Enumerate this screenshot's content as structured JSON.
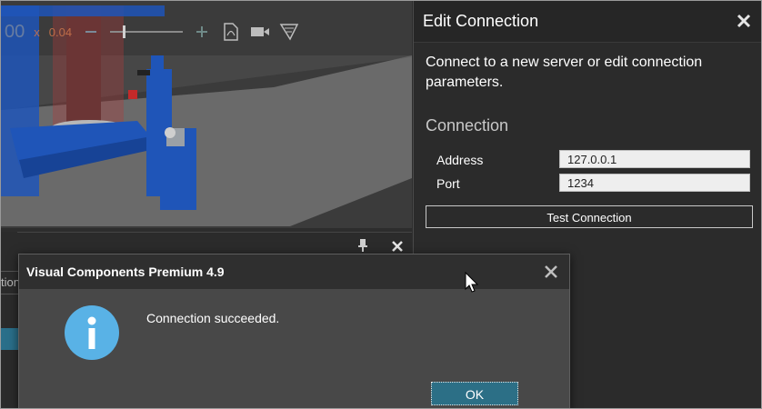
{
  "viewport": {
    "zoom_value": "00",
    "scale_prefix": "x",
    "scale_value": "0.04",
    "toolbar_icons": [
      "zoom-minus-icon",
      "slider-icon",
      "zoom-plus-icon",
      "pdf-export-icon",
      "video-record-icon",
      "render-mode-icon"
    ]
  },
  "edit_connection": {
    "title": "Edit Connection",
    "description": "Connect to a new server or edit connection parameters.",
    "section_title": "Connection",
    "address_label": "Address",
    "address_value": "127.0.0.1",
    "port_label": "Port",
    "port_value": "1234",
    "test_button": "Test Connection"
  },
  "lower_panel": {
    "tab_fragment": "tion"
  },
  "dialog": {
    "title": "Visual Components Premium 4.9",
    "message": "Connection succeeded.",
    "ok_button": "OK",
    "icon": "info-icon"
  },
  "colors": {
    "accent": "#2c6f86",
    "info_blue": "#59b2e6",
    "robot_blue": "#1f55b8",
    "panel_bg": "#2b2b2b",
    "dialog_bg": "#484848"
  }
}
